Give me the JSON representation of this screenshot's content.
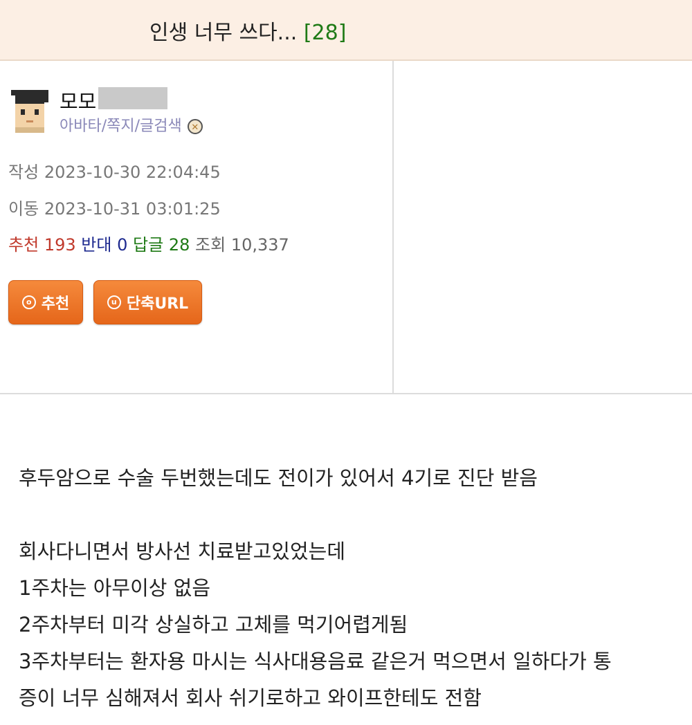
{
  "post": {
    "title": "인생 너무 쓰다...",
    "reply_count_badge": "[28]"
  },
  "author": {
    "name_visible": "모모",
    "links": {
      "avatar": "아바타",
      "message": "쪽지",
      "search": "글검색"
    },
    "separator": "/"
  },
  "meta": {
    "written_label": "작성",
    "written_value": "2023-10-30 22:04:45",
    "moved_label": "이동",
    "moved_value": "2023-10-31 03:01:25",
    "recommend_label": "추천",
    "recommend_value": "193",
    "oppose_label": "반대",
    "oppose_value": "0",
    "reply_label": "답글",
    "reply_value": "28",
    "views_label": "조회",
    "views_value": "10,337"
  },
  "buttons": {
    "recommend_icon": "o",
    "recommend_label": "추천",
    "shorturl_icon": "u",
    "shorturl_label": "단축URL"
  },
  "body": {
    "line1": "후두암으로 수술 두번했는데도 전이가 있어서 4기로 진단 받음",
    "line2": "회사다니면서 방사선 치료받고있었는데",
    "line3": "1주차는 아무이상 없음",
    "line4": "2주차부터 미각 상실하고 고체를 먹기어렵게됨",
    "line5": "3주차부터는 환자용 마시는 식사대용음료 같은거 먹으면서 일하다가 통",
    "line6": "증이 너무 심해져서 회사 쉬기로하고 와이프한테도 전함"
  },
  "colors": {
    "title_bg": "#fcefe4",
    "recommend": "#c0392b",
    "oppose": "#1e2a8f",
    "reply": "#1f7a16",
    "button_orange": "#ee7428"
  }
}
